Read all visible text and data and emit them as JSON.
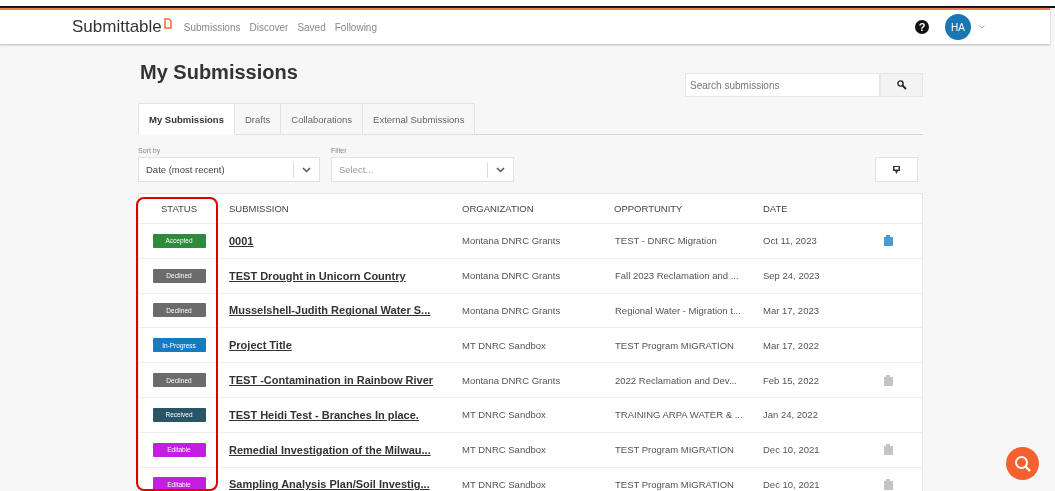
{
  "header": {
    "logo": "Submittable",
    "nav": [
      {
        "label": "Submissions"
      },
      {
        "label": "Discover"
      },
      {
        "label": "Saved"
      },
      {
        "label": "Following"
      }
    ],
    "help": "?",
    "avatar": "HA"
  },
  "page": {
    "title": "My Submissions",
    "search": {
      "placeholder": "Search submissions"
    }
  },
  "tabs": [
    {
      "label": "My Submissions",
      "selected": true
    },
    {
      "label": "Drafts",
      "selected": false
    },
    {
      "label": "Collaborations",
      "selected": false
    },
    {
      "label": "External Submissions",
      "selected": false
    }
  ],
  "sort": {
    "label": "Sort by",
    "value": "Date (most recent)"
  },
  "filter": {
    "label": "Filter",
    "placeholder": "Select..."
  },
  "table": {
    "columns": [
      "STATUS",
      "SUBMISSION",
      "ORGANIZATION",
      "OPPORTUNITY",
      "DATE"
    ],
    "rows": [
      {
        "status": "Accepted",
        "color": "#2e8b3e",
        "submission": "0001",
        "organization": "Montana DNRC Grants",
        "opportunity": "TEST - DNRC Migration",
        "date": "Oct 11, 2023",
        "file": {
          "color": "#4a9ad4"
        }
      },
      {
        "status": "Declined",
        "color": "#6b6b6b",
        "submission": "TEST Drought in Unicorn Country",
        "organization": "Montana DNRC Grants",
        "opportunity": "Fall 2023 Reclamation and ...",
        "date": "Sep 24, 2023"
      },
      {
        "status": "Declined",
        "color": "#6b6b6b",
        "submission": "Musselshell-Judith Regional Water S...",
        "organization": "Montana DNRC Grants",
        "opportunity": "Regional Water - Migration t...",
        "date": "Mar 17, 2023"
      },
      {
        "status": "In-Progress",
        "color": "#1a7ac0",
        "submission": "Project Title",
        "organization": "MT DNRC Sandbox",
        "opportunity": "TEST Program MIGRATION",
        "date": "Mar 17, 2022"
      },
      {
        "status": "Declined",
        "color": "#6b6b6b",
        "submission": "TEST -Contamination in Rainbow River",
        "organization": "Montana DNRC Grants",
        "opportunity": "2022 Reclamation and Dev...",
        "date": "Feb 15, 2022",
        "file": {
          "color": "#c4c4c4"
        }
      },
      {
        "status": "Received",
        "color": "#2a5566",
        "submission": "TEST Heidi Test - Branches In place.",
        "organization": "MT DNRC Sandbox",
        "opportunity": "TRAINING ARPA WATER & ...",
        "date": "Jan 24, 2022"
      },
      {
        "status": "Editable",
        "color": "#c41fe0",
        "submission": "Remedial Investigation of the Milwau...",
        "organization": "MT DNRC Sandbox",
        "opportunity": "TEST Program MIGRATION",
        "date": "Dec 10, 2021",
        "file": {
          "color": "#c4c4c4"
        }
      },
      {
        "status": "Editable",
        "color": "#c41fe0",
        "submission": "Sampling Analysis Plan/Soil Investig...",
        "organization": "MT DNRC Sandbox",
        "opportunity": "TEST Program MIGRATION",
        "date": "Dec 10, 2021",
        "file": {
          "color": "#c4c4c4"
        }
      }
    ]
  }
}
